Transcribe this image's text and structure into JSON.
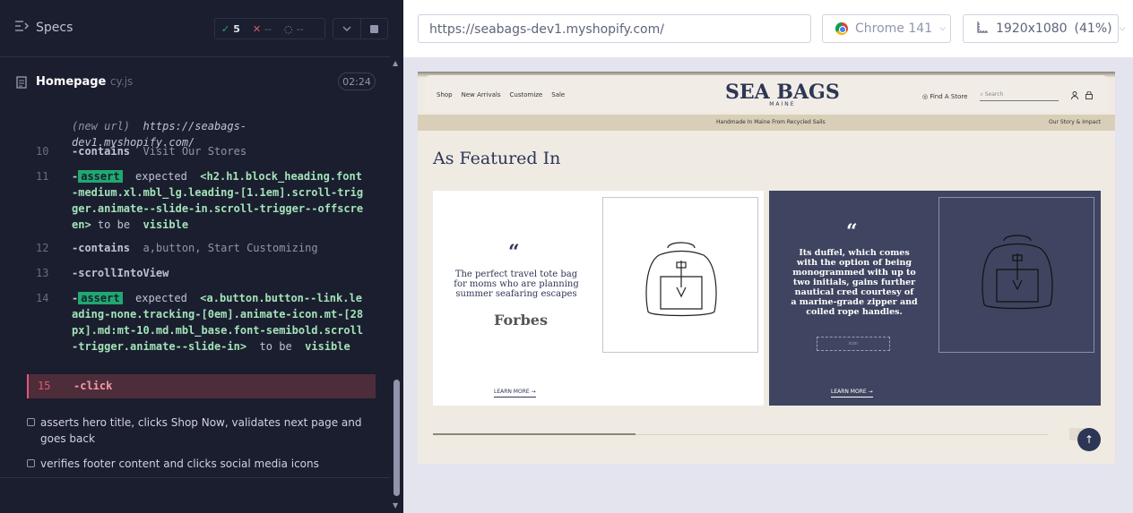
{
  "specs": {
    "title": "Specs",
    "passed": "5",
    "failed": "--",
    "pending": "--"
  },
  "file": {
    "name": "Homepage",
    "ext": "cy.js",
    "duration": "02:24"
  },
  "commands": {
    "new_url_label": "(new url)",
    "new_url": "https://seabags-dev1.myshopify.com/",
    "c10_num": "10",
    "c10_name": "-contains",
    "c10_arg": "Visit Our Stores",
    "c11_num": "11",
    "c11_dash": "-",
    "c11_badge": "assert",
    "c11_text1": "expected",
    "c11_sel": "<h2.h1.block_heading.font-medium.xl.mbl_lg.leading-[1.1em].scroll-trigger.animate--slide-in.scroll-trigger--offscreen>",
    "c11_text2": "to be",
    "c11_text3": "visible",
    "c12_num": "12",
    "c12_name": "-contains",
    "c12_arg": "a,button, Start Customizing",
    "c13_num": "13",
    "c13_name": "-scrollIntoView",
    "c14_num": "14",
    "c14_dash": "-",
    "c14_badge": "assert",
    "c14_text1": "expected",
    "c14_sel": "<a.button.button--link.leading-none.tracking-[0em].animate-icon.mt-[28px].md:mt-10.md.mbl_base.font-semibold.scroll-trigger.animate--slide-in>",
    "c14_text2": "to",
    "c14_text3": "be",
    "c14_text4": "visible",
    "c15_num": "15",
    "c15_name": "-click"
  },
  "tests": {
    "t1": "asserts hero title, clicks Shop Now, validates next page and goes back",
    "t2": "verifies footer content and clicks social media icons"
  },
  "browser_bar": {
    "url": "https://seabags-dev1.myshopify.com/",
    "browser": "Chrome 141",
    "viewport": "1920x1080",
    "scale": "(41%)"
  },
  "site": {
    "nav": [
      "Shop",
      "New Arrivals",
      "Customize",
      "Sale"
    ],
    "logo": "SEA BAGS",
    "logo_sub": "MAINE",
    "find_store": "Find A Store",
    "search_placeholder": "Search",
    "announce_center": "Handmade In Maine From Recycled Sails",
    "announce_right": "Our Story & Impact",
    "featured_title": "As Featured In",
    "card1_quote_mark": "“",
    "card1_quote": "The perfect travel tote bag for moms who are planning summer seafaring escapes",
    "card1_brand": "Forbes",
    "card1_learn": "LEARN MORE →",
    "card2_quote_mark": "“",
    "card2_quote": "Its duffel, which comes with the option of being monogrammed with up to two initials, gains further nautical cred courtesy of a marine-grade zipper and coiled rope handles.",
    "card2_icon_label": "icon",
    "card2_learn": "LEARN MORE →",
    "slider_progress": 0.33
  },
  "colors": {
    "pass": "#1fa971",
    "fail": "#e45770",
    "navy": "#2e3655",
    "card_dark": "#3f4560"
  }
}
